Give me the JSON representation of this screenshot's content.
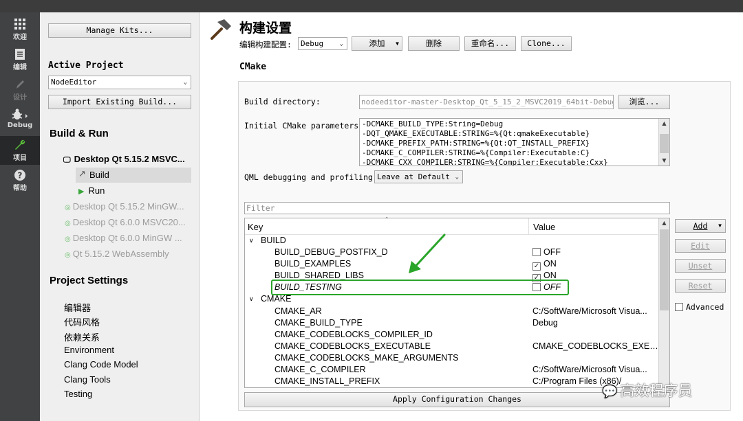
{
  "modes": [
    {
      "label": "欢迎",
      "icon": "grid-icon"
    },
    {
      "label": "编辑",
      "icon": "document-icon"
    },
    {
      "label": "设计",
      "icon": "pencil-icon"
    },
    {
      "label": "Debug",
      "icon": "bug-icon"
    },
    {
      "label": "项目",
      "icon": "wrench-icon"
    },
    {
      "label": "帮助",
      "icon": "help-icon"
    }
  ],
  "sidebar": {
    "manage_kits": "Manage Kits...",
    "active_project_title": "Active Project",
    "active_project_value": "NodeEditor",
    "import_build": "Import Existing Build...",
    "build_run_title": "Build & Run",
    "kits": [
      {
        "label": "Desktop Qt 5.15.2 MSVC..."
      },
      {
        "label": "Build"
      },
      {
        "label": "Run"
      },
      {
        "label": "Desktop Qt 5.15.2 MinGW..."
      },
      {
        "label": "Desktop Qt 6.0.0 MSVC20..."
      },
      {
        "label": "Desktop Qt 6.0.0 MinGW ..."
      },
      {
        "label": "Qt 5.15.2 WebAssembly"
      }
    ],
    "project_settings_title": "Project Settings",
    "settings": [
      "编辑器",
      "代码风格",
      "依赖关系",
      "Environment",
      "Clang Code Model",
      "Clang Tools",
      "Testing"
    ]
  },
  "header": {
    "title": "构建设置",
    "edit_config_label": "编辑构建配置:",
    "config_value": "Debug",
    "add": "添加",
    "delete": "删除",
    "rename": "重命名...",
    "clone": "Clone..."
  },
  "cmake": {
    "section_title": "CMake",
    "build_dir_label": "Build directory:",
    "build_dir_value": "nodeeditor-master-Desktop_Qt_5_15_2_MSVC2019_64bit-Debug",
    "browse": "浏览...",
    "initial_params_label": "Initial CMake parameters:",
    "initial_params": [
      "-DCMAKE_BUILD_TYPE:String=Debug",
      "-DQT_QMAKE_EXECUTABLE:STRING=%{Qt:qmakeExecutable}",
      "-DCMAKE_PREFIX_PATH:STRING=%{Qt:QT_INSTALL_PREFIX}",
      "-DCMAKE_C_COMPILER:STRING=%{Compiler:Executable:C}",
      "-DCMAKE_CXX_COMPILER:STRING=%{Compiler:Executable:Cxx}"
    ],
    "qml_label": "QML debugging and profiling:",
    "qml_value": "Leave at Default",
    "filter_placeholder": "Filter",
    "col_key": "Key",
    "col_value": "Value",
    "groups": {
      "build": "BUILD",
      "cmake": "CMAKE"
    },
    "build_rows": [
      {
        "key": "BUILD_DEBUG_POSTFIX_D",
        "value": "OFF",
        "checked": false
      },
      {
        "key": "BUILD_EXAMPLES",
        "value": "ON",
        "checked": true
      },
      {
        "key": "BUILD_SHARED_LIBS",
        "value": "ON",
        "checked": true
      },
      {
        "key": "BUILD_TESTING",
        "value": "OFF",
        "checked": false
      }
    ],
    "cmake_rows": [
      {
        "key": "CMAKE_AR",
        "value": "C:/SoftWare/Microsoft Visua..."
      },
      {
        "key": "CMAKE_BUILD_TYPE",
        "value": "Debug"
      },
      {
        "key": "CMAKE_CODEBLOCKS_COMPILER_ID",
        "value": ""
      },
      {
        "key": "CMAKE_CODEBLOCKS_EXECUTABLE",
        "value": "CMAKE_CODEBLOCKS_EXEC..."
      },
      {
        "key": "CMAKE_CODEBLOCKS_MAKE_ARGUMENTS",
        "value": ""
      },
      {
        "key": "CMAKE_C_COMPILER",
        "value": "C:/SoftWare/Microsoft Visua..."
      },
      {
        "key": "CMAKE_INSTALL_PREFIX",
        "value": "C:/Program Files (x86)/"
      }
    ],
    "side_buttons": {
      "add": "Add",
      "edit": "Edit",
      "unset": "Unset",
      "reset": "Reset"
    },
    "advanced": "Advanced",
    "apply": "Apply Configuration Changes"
  },
  "watermark": "高效程序员",
  "colors": {
    "highlight": "#2aa52a",
    "sidebar_bg": "#efefef",
    "modebar_bg": "#404244"
  }
}
